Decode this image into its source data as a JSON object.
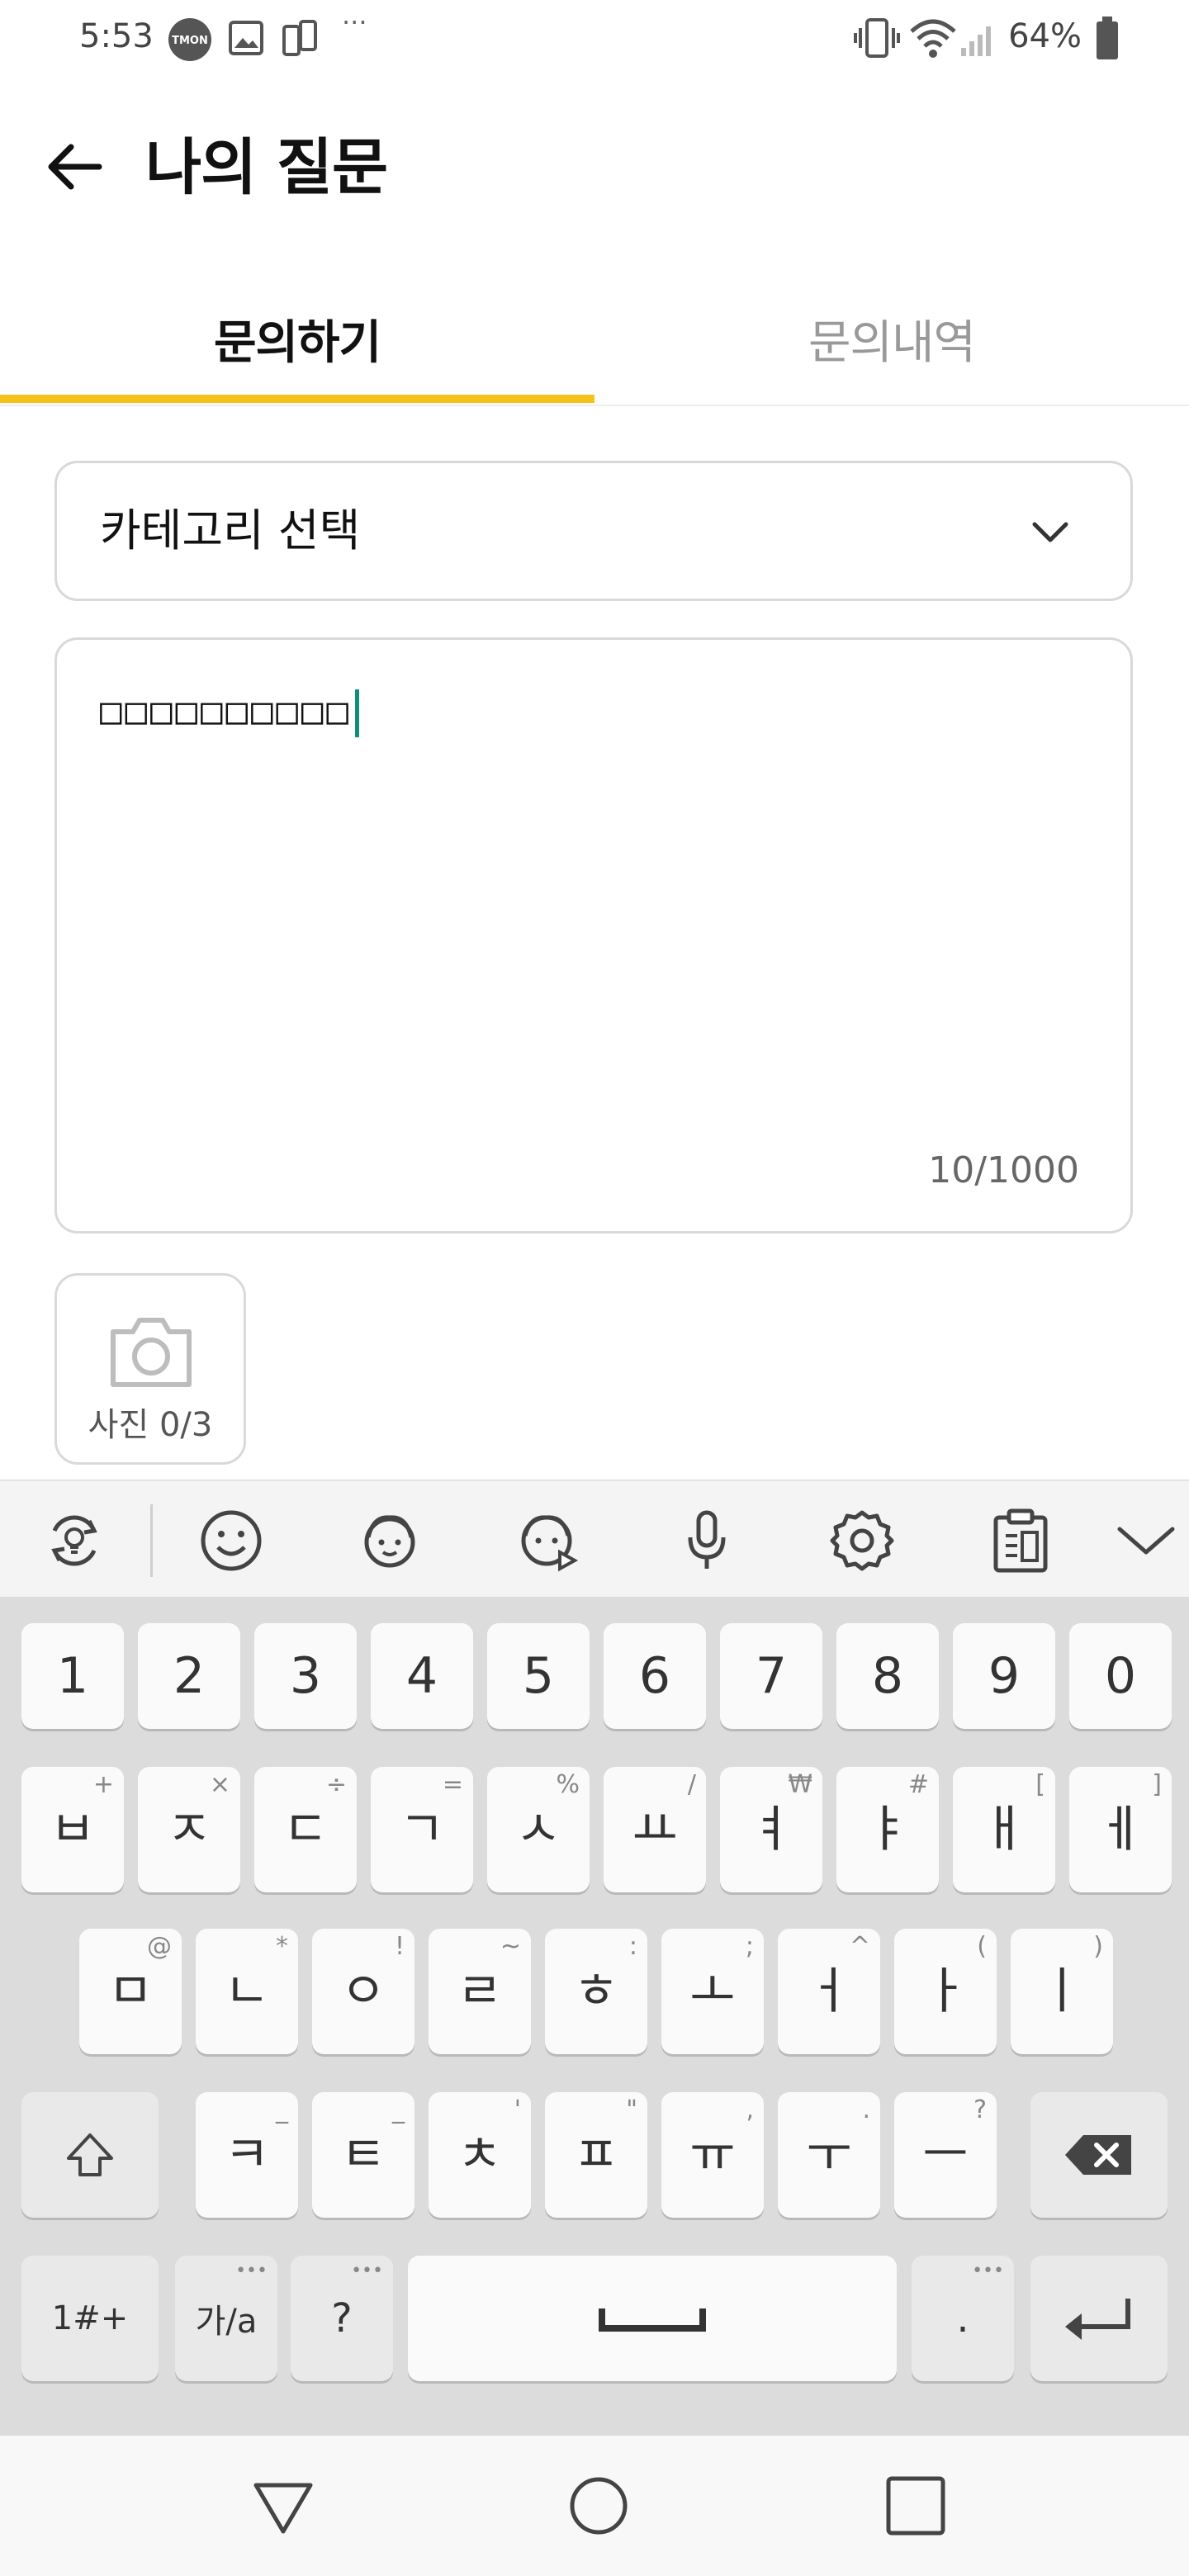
{
  "status_bar": {
    "time": "5:53",
    "app_badge": "TMON",
    "overflow": "···",
    "battery": "64%"
  },
  "header": {
    "title": "나의 질문"
  },
  "tabs": [
    {
      "label": "문의하기",
      "active": true
    },
    {
      "label": "문의내역",
      "active": false
    }
  ],
  "form": {
    "category_placeholder": "카테고리 선택",
    "question_text": "□□□□□□□□□□",
    "char_count": "10/1000",
    "photo_label": "사진 0/3"
  },
  "keyboard": {
    "row1": [
      {
        "main": "1"
      },
      {
        "main": "2"
      },
      {
        "main": "3"
      },
      {
        "main": "4"
      },
      {
        "main": "5"
      },
      {
        "main": "6"
      },
      {
        "main": "7"
      },
      {
        "main": "8"
      },
      {
        "main": "9"
      },
      {
        "main": "0"
      }
    ],
    "row2": [
      {
        "main": "ㅂ",
        "sub": "+"
      },
      {
        "main": "ㅈ",
        "sub": "×"
      },
      {
        "main": "ㄷ",
        "sub": "÷"
      },
      {
        "main": "ㄱ",
        "sub": "="
      },
      {
        "main": "ㅅ",
        "sub": "%"
      },
      {
        "main": "ㅛ",
        "sub": "/"
      },
      {
        "main": "ㅕ",
        "sub": "₩"
      },
      {
        "main": "ㅑ",
        "sub": "#"
      },
      {
        "main": "ㅐ",
        "sub": "["
      },
      {
        "main": "ㅔ",
        "sub": "]"
      }
    ],
    "row3": [
      {
        "main": "ㅁ",
        "sub": "@"
      },
      {
        "main": "ㄴ",
        "sub": "*"
      },
      {
        "main": "ㅇ",
        "sub": "!"
      },
      {
        "main": "ㄹ",
        "sub": "~"
      },
      {
        "main": "ㅎ",
        "sub": ":"
      },
      {
        "main": "ㅗ",
        "sub": ";"
      },
      {
        "main": "ㅓ",
        "sub": "^"
      },
      {
        "main": "ㅏ",
        "sub": "("
      },
      {
        "main": "ㅣ",
        "sub": ")"
      }
    ],
    "row4": [
      {
        "main": "ㅋ",
        "sub": "_"
      },
      {
        "main": "ㅌ",
        "sub": "_"
      },
      {
        "main": "ㅊ",
        "sub": "'"
      },
      {
        "main": "ㅍ",
        "sub": "\""
      },
      {
        "main": "ㅠ",
        "sub": ","
      },
      {
        "main": "ㅜ",
        "sub": "."
      },
      {
        "main": "ㅡ",
        "sub": "?"
      }
    ],
    "symbols_key": "1#+",
    "lang_key": "가/a",
    "question_key": "?",
    "period_key": ".",
    "more_dots": "•••"
  },
  "icons": {
    "toolbar": [
      "refresh-bulb-icon",
      "emoji-icon",
      "sticker-icon",
      "animated-sticker-icon",
      "mic-icon",
      "settings-icon",
      "clipboard-icon",
      "collapse-chevron-icon"
    ],
    "nav": [
      "back-triangle-icon",
      "home-circle-icon",
      "recents-square-icon"
    ]
  },
  "colors": {
    "accent": "#f6c11b",
    "caret": "#0f8f7a",
    "border": "#d9d9d9",
    "inactive_tab": "#999999"
  }
}
